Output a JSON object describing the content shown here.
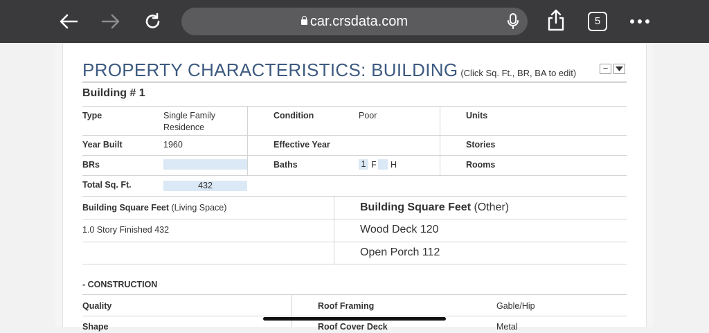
{
  "browser": {
    "url": "car.crsdata.com",
    "tab_count": "5"
  },
  "section": {
    "title": "PROPERTY CHARACTERISTICS: BUILDING",
    "note": "(Click Sq. Ft., BR, BA to edit)",
    "collapse_label": "−"
  },
  "building": {
    "heading": "Building # 1",
    "type_label": "Type",
    "type_value": "Single Family Residence",
    "condition_label": "Condition",
    "condition_value": "Poor",
    "units_label": "Units",
    "year_built_label": "Year Built",
    "year_built_value": "1960",
    "effective_year_label": "Effective Year",
    "stories_label": "Stories",
    "brs_label": "BRs",
    "baths_label": "Baths",
    "baths_full_value": "1",
    "baths_full_suffix": "F",
    "baths_half_suffix": "H",
    "rooms_label": "Rooms",
    "total_sqft_label": "Total Sq. Ft.",
    "total_sqft_value": "432"
  },
  "sqft": {
    "living_label_bold": "Building Square Feet",
    "living_label_rest": " (Living Space)",
    "other_label_bold": "Building Square Feet",
    "other_label_rest": " (Other)",
    "living_items": [
      "1.0 Story Finished 432"
    ],
    "other_items": [
      "Wood Deck 120",
      "Open Porch 112"
    ]
  },
  "construction": {
    "heading": "- CONSTRUCTION",
    "quality_label": "Quality",
    "roof_framing_label": "Roof Framing",
    "roof_framing_value": "Gable/Hip",
    "shape_label": "Shape",
    "roof_cover_label": "Roof Cover Deck",
    "roof_cover_value": "Metal"
  }
}
